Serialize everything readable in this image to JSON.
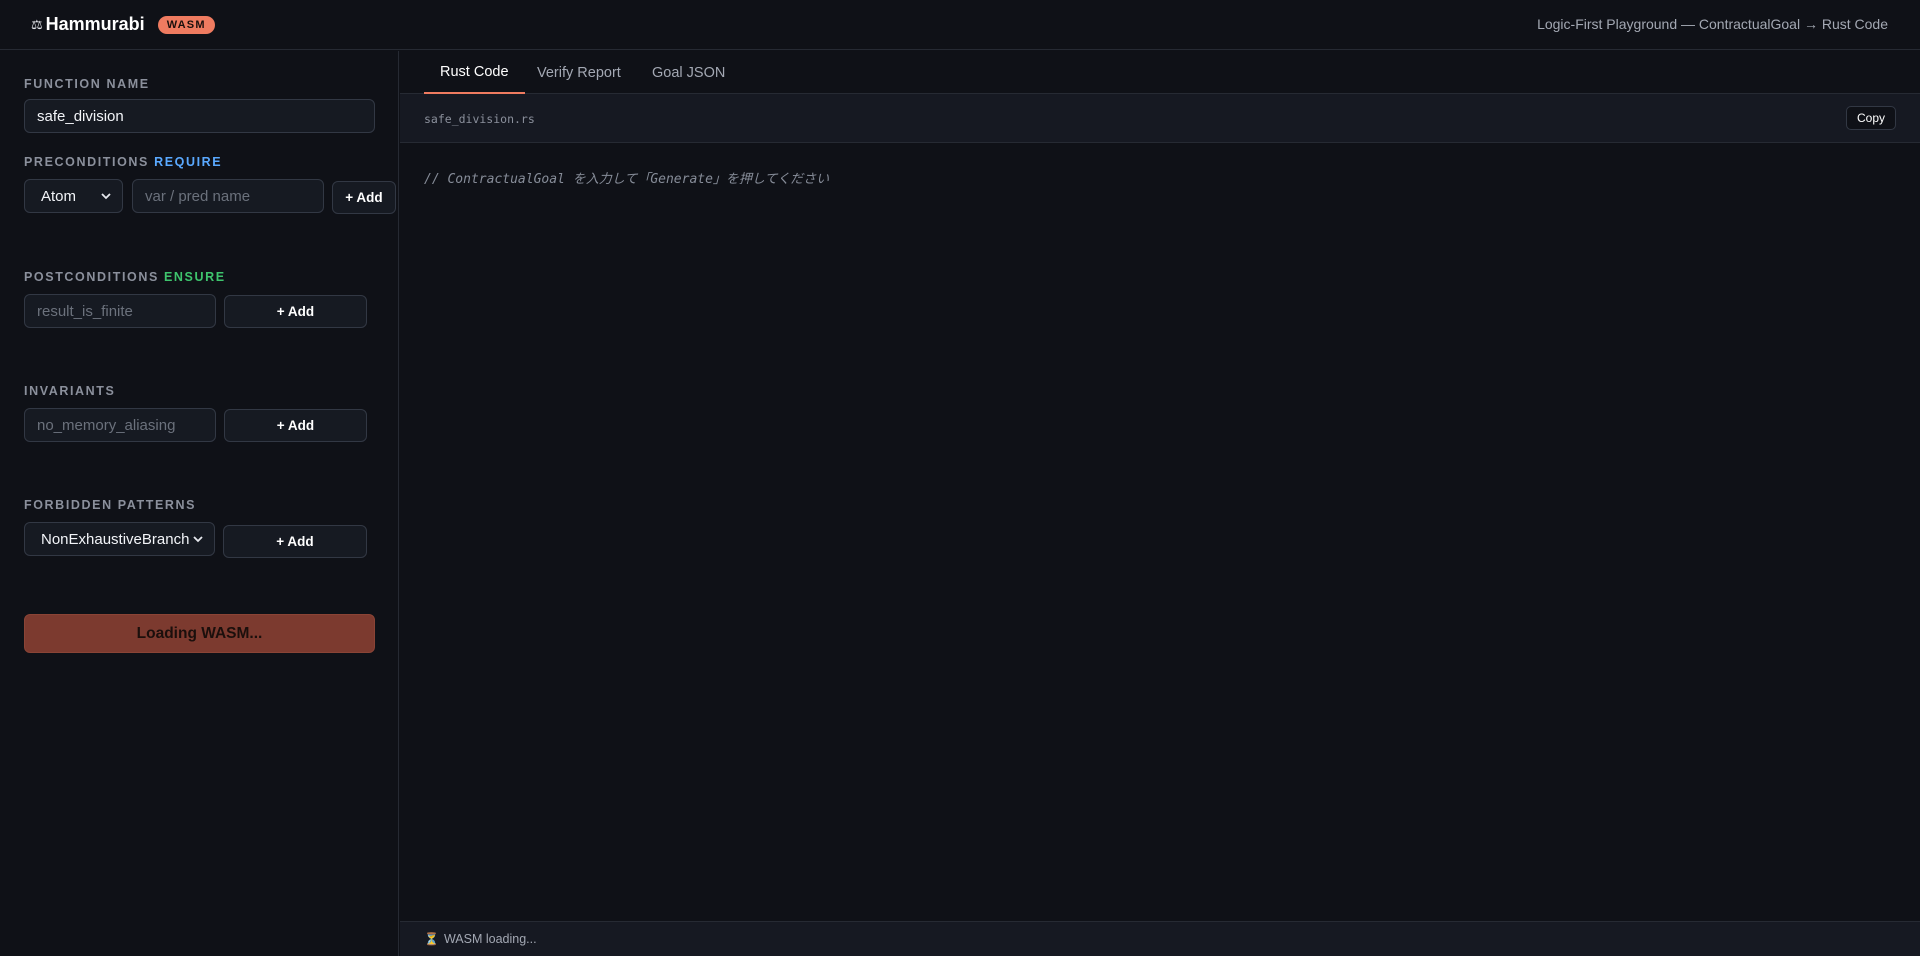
{
  "header": {
    "brand_icon": "⚖",
    "brand_name": "Hammurabi",
    "badge": "WASM",
    "title": "Logic-First Playground — ContractualGoal → Rust Code"
  },
  "sidebar": {
    "function_name": {
      "label": "FUNCTION NAME",
      "value": "safe_division"
    },
    "preconditions": {
      "label": "PRECONDITIONS",
      "keyword": "REQUIRE",
      "type_select": "Atom",
      "placeholder": "var / pred name",
      "add_label": "+ Add"
    },
    "postconditions": {
      "label": "POSTCONDITIONS",
      "keyword": "ENSURE",
      "placeholder": "result_is_finite",
      "add_label": "+ Add"
    },
    "invariants": {
      "label": "INVARIANTS",
      "placeholder": "no_memory_aliasing",
      "add_label": "+ Add"
    },
    "forbidden_patterns": {
      "label": "FORBIDDEN PATTERNS",
      "select": "NonExhaustiveBranch",
      "add_label": "+ Add"
    },
    "generate_label": "Loading WASM..."
  },
  "main": {
    "tabs": [
      {
        "label": "Rust Code",
        "active": true
      },
      {
        "label": "Verify Report",
        "active": false
      },
      {
        "label": "Goal JSON",
        "active": false
      }
    ],
    "filename": "safe_division.rs",
    "copy_label": "Copy",
    "code_text": "// ContractualGoal を入力して「Generate」を押してください"
  },
  "status": {
    "icon": "hourglass-icon",
    "glyph": "⏳",
    "text": "WASM loading..."
  },
  "colors": {
    "accent": "#ef7b60",
    "require": "#5aa9ff",
    "ensure": "#3ec46d",
    "background": "#0f1117"
  }
}
